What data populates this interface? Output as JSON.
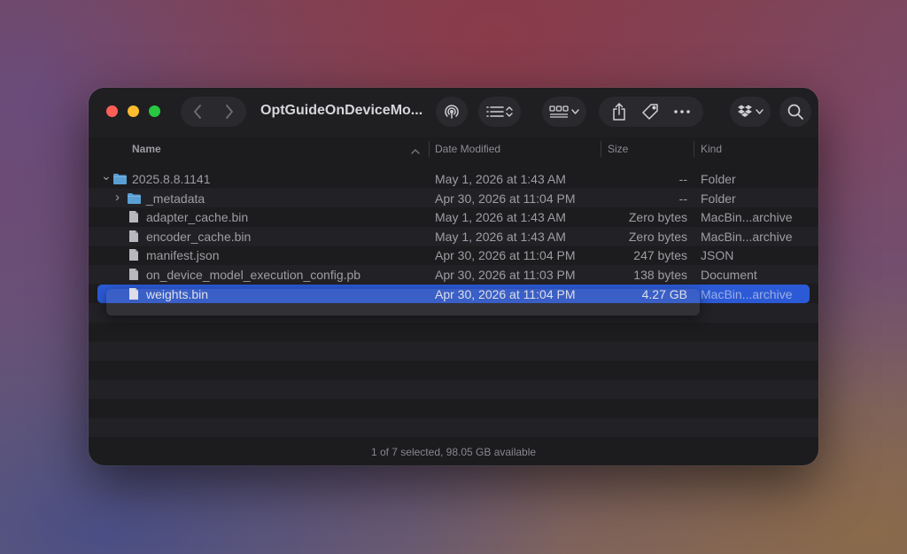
{
  "window": {
    "title": "OptGuideOnDeviceMo...",
    "status_text": "1 of 7 selected, 98.05 GB available"
  },
  "toolbar_icons": {
    "back": "chevron-left-icon",
    "forward": "chevron-right-icon",
    "airdrop": "airdrop-icon",
    "list_view": "list-view-icon",
    "group": "grid-group-icon",
    "share": "share-icon",
    "tag": "tag-icon",
    "more": "ellipsis-icon",
    "dropbox": "dropbox-icon",
    "search": "search-icon"
  },
  "columns": {
    "name": "Name",
    "date": "Date Modified",
    "size": "Size",
    "kind": "Kind"
  },
  "files": [
    {
      "name": "2025.8.8.1141",
      "date": "May 1, 2026 at 1:43 AM",
      "size": "--",
      "kind": "Folder",
      "type": "folder",
      "expanded": true,
      "indent": 0
    },
    {
      "name": "_metadata",
      "date": "Apr 30, 2026 at 11:04 PM",
      "size": "--",
      "kind": "Folder",
      "type": "folder",
      "expanded": false,
      "indent": 1
    },
    {
      "name": "adapter_cache.bin",
      "date": "May 1, 2026 at 1:43 AM",
      "size": "Zero bytes",
      "kind": "MacBin...archive",
      "type": "file",
      "indent": 1
    },
    {
      "name": "encoder_cache.bin",
      "date": "May 1, 2026 at 1:43 AM",
      "size": "Zero bytes",
      "kind": "MacBin...archive",
      "type": "file",
      "indent": 1
    },
    {
      "name": "manifest.json",
      "date": "Apr 30, 2026 at 11:04 PM",
      "size": "247 bytes",
      "kind": "JSON",
      "type": "file",
      "indent": 1
    },
    {
      "name": "on_device_model_execution_config.pb",
      "date": "Apr 30, 2026 at 11:03 PM",
      "size": "138 bytes",
      "kind": "Document",
      "type": "file",
      "indent": 1
    },
    {
      "name": "weights.bin",
      "date": "Apr 30, 2026 at 11:04 PM",
      "size": "4.27 GB",
      "kind": "MacBin...archive",
      "type": "file",
      "indent": 1,
      "selected": true
    }
  ],
  "colors": {
    "selection": "#2c5ad6",
    "folder": "#5a9fd4",
    "close": "#ff5f57",
    "minimize": "#febc2e",
    "zoom": "#28c840"
  }
}
